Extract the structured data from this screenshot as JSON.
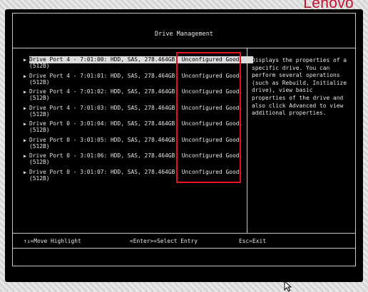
{
  "brand": "Lenovo",
  "screen": {
    "title": "Drive Management",
    "drives": [
      {
        "line1": "Drive Port 4 - 7:01:00: HDD, SAS, 278.464GB, Unconfigured Good,",
        "line2": "(512B)"
      },
      {
        "line1": "Drive Port 4 - 7:01:01: HDD, SAS, 278.464GB, Unconfigured Good,",
        "line2": "(512B)"
      },
      {
        "line1": "Drive Port 4 - 7:01:02: HDD, SAS, 278.464GB, Unconfigured Good,",
        "line2": "(512B)"
      },
      {
        "line1": "Drive Port 4 - 7:01:03: HDD, SAS, 278.464GB, Unconfigured Good,",
        "line2": "(512B)"
      },
      {
        "line1": "Drive Port 0 - 3:01:04: HDD, SAS, 278.464GB, Unconfigured Good,",
        "line2": "(512B)"
      },
      {
        "line1": "Drive Port 0 - 3:01:05: HDD, SAS, 278.464GB, Unconfigured Good,",
        "line2": "(512B)"
      },
      {
        "line1": "Drive Port 0 - 3:01:06: HDD, SAS, 278.464GB, Unconfigured Good,",
        "line2": "(512B)"
      },
      {
        "line1": "Drive Port 0 - 3:01:07: HDD, SAS, 278.464GB, Unconfigured Good,",
        "line2": "(512B)"
      }
    ],
    "help_text": "Displays the properties of a\nspecific drive. You can\nperform several operations\n(such as Rebuild, Initialize\ndrive), view basic\nproperties of the drive and\nalso click Advanced to view\nadditional properties.",
    "footer": {
      "move": "↑↓=Move Highlight",
      "select": "<Enter>=Select Entry",
      "exit": "Esc=Exit"
    }
  },
  "colors": {
    "screen_bg": "#000000",
    "text": "#e6e6e6",
    "selection_bg": "#dcdcdc",
    "annotation_red": "#e0151f",
    "brand_red": "#c8102e"
  },
  "icons": {
    "item_marker": "right-triangle-icon",
    "cursor": "mouse-pointer-icon"
  }
}
